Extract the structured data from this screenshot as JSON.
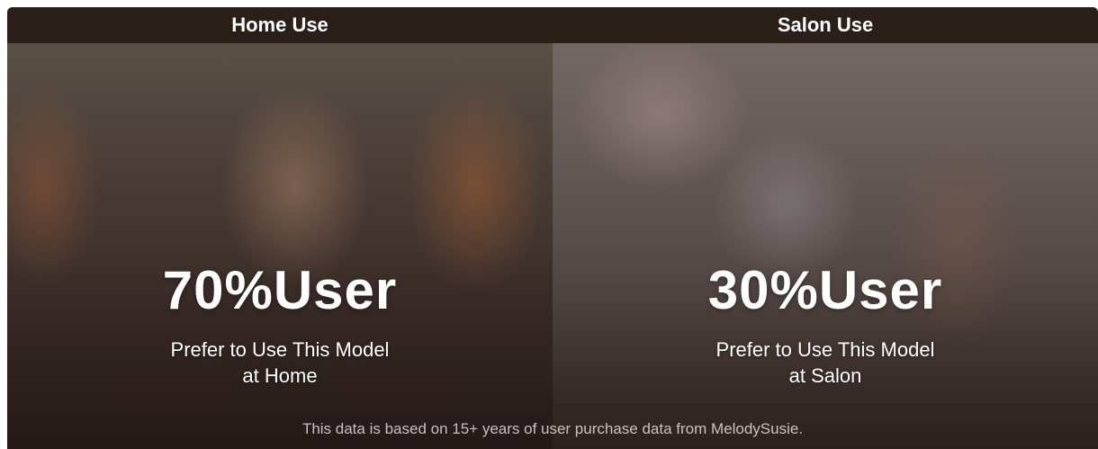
{
  "panels": {
    "home": {
      "header": "Home Use",
      "stat": "70%User",
      "caption_line1": "Prefer to Use This Model",
      "caption_line2": "at Home",
      "photo_icon": "photo-friends-painting-nails-icon"
    },
    "salon": {
      "header": "Salon Use",
      "stat": "30%User",
      "caption_line1": "Prefer to Use This Model",
      "caption_line2": "at Salon",
      "photo_icon": "photo-nail-salon-icon"
    }
  },
  "footnote": "This data is based on 15+ years of user purchase data from MelodySusie.",
  "colors": {
    "header_bg": "#2b1f1a",
    "text": "#ffffff"
  }
}
